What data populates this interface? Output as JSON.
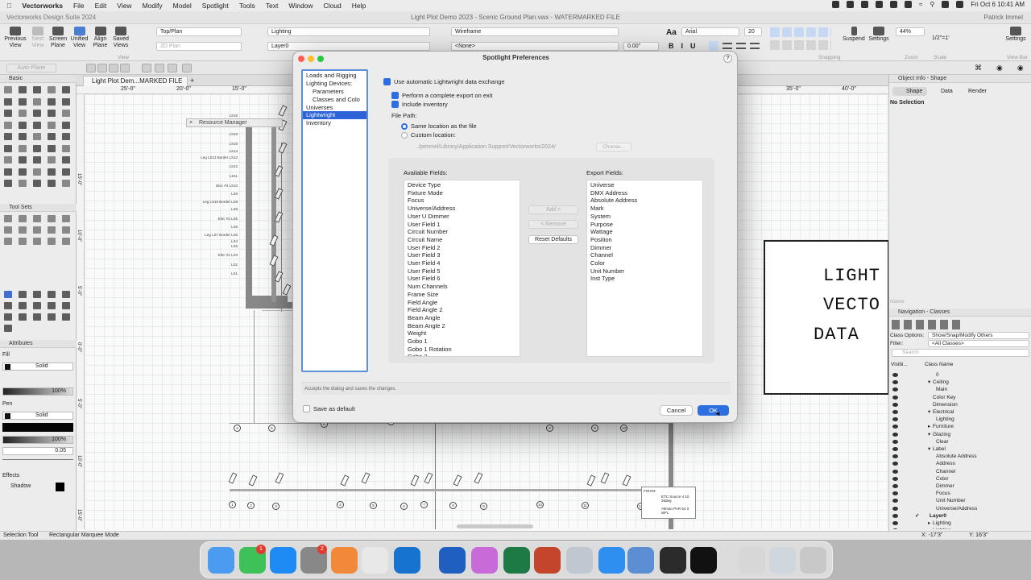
{
  "menubar": {
    "app": "Vectorworks",
    "items": [
      "File",
      "Edit",
      "View",
      "Modify",
      "Model",
      "Spotlight",
      "Tools",
      "Text",
      "Window",
      "Cloud",
      "Help"
    ],
    "clock": "Fri Oct 6  10:41 AM"
  },
  "titlebar": {
    "app_title": "Vectorworks Design Suite 2024",
    "doc_title": "Light Plot Demo 2023 - Scenic Ground Plan.vwx - WATERMARKED FILE",
    "user": "Patrick Immel"
  },
  "toolbar": {
    "previous_view": "Previous View",
    "next_view": "Next View",
    "screen_plane": "Screen Plane",
    "unified_view": "Unified View",
    "align_plane": "Align Plane",
    "saved_views": "Saved Views",
    "view_field": "Top/Plan",
    "plane_field": "2D Plan",
    "class_field": "Lighting",
    "layer_field": "Layer0",
    "render_field": "Wireframe",
    "projection_field": "<None>",
    "line_weight": "0.00\"",
    "font_name": "Arial",
    "font_size": "20",
    "zoom": "44%",
    "scale": "1/2\"=1'",
    "suspend": "Suspend",
    "settings": "Settings",
    "settings2": "Settings",
    "group_view": "View",
    "group_snapping": "Snapping",
    "group_zoom": "Zoom",
    "group_scale": "Scale",
    "group_viewbar": "View Bar",
    "auto_plane": "Auto-Plane"
  },
  "left": {
    "basic": "Basic",
    "tool_sets": "Tool Sets",
    "attributes": "Attributes",
    "fill": "Fill",
    "fill_style": "Solid",
    "fill_opacity": "100%",
    "pen": "Pen",
    "pen_style": "Solid",
    "pen_opacity": "100%",
    "line_weight": "0.05",
    "effects": "Effects",
    "shadow": "Shadow"
  },
  "drawing": {
    "tab": "Light Plot Dem...MARKED FILE",
    "resource_manager": "Resource Manager",
    "ruler": [
      "25'-0\"",
      "20'-0\"",
      "15'-0\"",
      "35'-0\"",
      "40'-0\""
    ],
    "vruler": [
      "15'-0\"",
      "10'-0\"",
      "5'-0\"",
      "0'-0\"",
      "5'-0\"",
      "10'-0\"",
      "15'-0\""
    ],
    "pipe_labels": [
      "LS18",
      "Elec #4 LS17",
      "LS16",
      "LS15",
      "LS14",
      "Leg LS13 Border LS12",
      "LS12",
      "LS11",
      "Elec #3 LS10",
      "LS9",
      "Leg LS10 Border LS8",
      "LS8",
      "Elec #2 LS6",
      "LS5",
      "Leg LS7 Border LS6",
      "LS4",
      "LS5",
      "Elec #1 LS3",
      "LS2",
      "LS1"
    ],
    "watermark": [
      "LIGHT",
      "VECTO",
      "DATA"
    ],
    "legend": {
      "title": "FOH#3",
      "rows": [
        "ETC Source 4  10  26deg",
        "Altman PAR 64  3  WFL"
      ]
    },
    "unit_numbers": [
      "1",
      "2",
      "3",
      "4",
      "5",
      "6",
      "7",
      "8",
      "9",
      "10",
      "11",
      "12",
      "13",
      "14",
      "15",
      "16"
    ]
  },
  "dialog": {
    "title": "Spotlight Preferences",
    "categories": [
      "Loads and Rigging",
      "Lighting Devices:",
      "Parameters",
      "Classes and Colo",
      "Universes",
      "Lightwright",
      "Inventory"
    ],
    "use_auto": "Use automatic Lightwright data exchange",
    "complete_export": "Perform a complete export on exit",
    "include_inventory": "Include inventory",
    "file_path": "File Path:",
    "same_location": "Same location as the file",
    "custom_location": "Custom location:",
    "path": "../pimmel/Library/Application Support/Vectorworks/2024/",
    "choose": "Choose...",
    "available_label": "Available Fields:",
    "export_label": "Export Fields:",
    "available_fields": [
      "Device Type",
      "Fixture Mode",
      "Focus",
      "Universe/Address",
      "User U Dimmer",
      "User Field 1",
      "Circuit Number",
      "Circuit Name",
      "User Field 2",
      "User Field 3",
      "User Field 4",
      "User Field 5",
      "User Field 6",
      "Num Channels",
      "Frame Size",
      "Field Angle",
      "Field Angle 2",
      "Beam Angle",
      "Beam Angle 2",
      "Weight",
      "Gobo 1",
      "Gobo 1 Rotation",
      "Gobo 2"
    ],
    "export_fields": [
      "Universe",
      "DMX Address",
      "Absolute Address",
      "Mark",
      "System",
      "Purpose",
      "Wattage",
      "Position",
      "Dimmer",
      "Channel",
      "Color",
      "Unit Number",
      "Inst Type"
    ],
    "add": "Add >",
    "remove": "< Remove",
    "reset": "Reset Defaults",
    "tooltip": "Accepts the dialog and saves the changes.",
    "save_default": "Save as default",
    "cancel": "Cancel",
    "ok": "OK"
  },
  "right": {
    "header": "Object Info - Shape",
    "tab_shape": "Shape",
    "tab_data": "Data",
    "tab_render": "Render",
    "no_selection": "No Selection",
    "name_label": "Name:",
    "nav_header": "Navigation - Classes",
    "class_options_label": "Class Options:",
    "class_options": "Show/Snap/Modify Others",
    "filter_label": "Filter:",
    "filter": "<All Classes>",
    "search": "Search",
    "col_visibility": "Visibi...",
    "col_class": "Class Name",
    "classes": [
      "0",
      "Ceiling",
      "Main",
      "Color Key",
      "Dimension",
      "Electrical",
      "Lighting",
      "Furniture",
      "Glazing",
      "Clear",
      "Label",
      "Absolute Address",
      "Address",
      "Channel",
      "Color",
      "Dimmer",
      "Focus",
      "Unit Number",
      "Universe/Address",
      "Layer0",
      "Lighting",
      "Lighting"
    ]
  },
  "statusbar": {
    "tool": "Selection Tool",
    "mode": "Rectangular Marquee Mode",
    "x": "X: -17'3\"",
    "y": "Y: 16'3\""
  },
  "dock": {
    "apps": [
      "finder",
      "messages",
      "app-store",
      "system-settings",
      "launchpad",
      "chrome",
      "outlook",
      "word",
      "color-app",
      "excel",
      "powerpoint",
      "preview",
      "safari",
      "vectorworks-s",
      "camera",
      "vectorworks"
    ],
    "badges": {
      "messages": "1",
      "system-settings": "2"
    }
  },
  "colors": {
    "accent": "#2d6fe0",
    "selected_row": "#2d63d6",
    "light_red": "#ff5f57",
    "light_yellow": "#febc2e",
    "light_green": "#28c840"
  }
}
